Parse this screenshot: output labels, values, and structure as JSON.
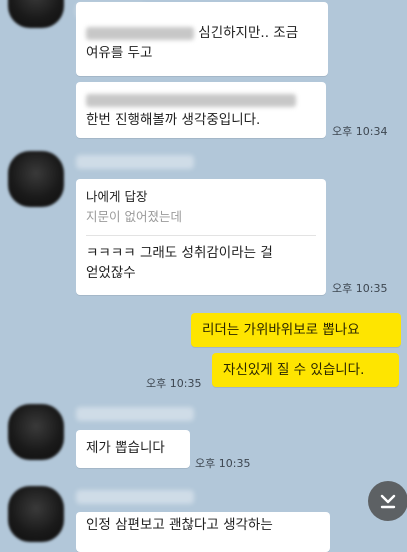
{
  "messages": [
    {
      "id": "m1",
      "visible_text_1": "심긴하지만.. 조금",
      "visible_text_2": "여유를 두고"
    },
    {
      "id": "m2",
      "visible_text_2": "한번 진행해볼까 생각중입니다.",
      "time": "오후 10:34"
    },
    {
      "id": "m3",
      "reply_header": "나에게 답장",
      "reply_quote": "지문이 없어졌는데",
      "text_line_1": "ㅋㅋㅋㅋ 그래도 성취감이라는 걸",
      "text_line_2": "얻었잖수",
      "time": "오후 10:35"
    },
    {
      "id": "m4",
      "text": "리더는 가위바위보로 뽑나요"
    },
    {
      "id": "m5",
      "text": "자신있게 질 수 있습니다.",
      "time": "오후 10:35"
    },
    {
      "id": "m6",
      "text": "제가 뽑습니다",
      "time": "오후 10:35"
    },
    {
      "id": "m7",
      "partial_text": "인정 삼편보고 괜찮다고 생각하는"
    }
  ],
  "scroll_button": {
    "icon": "chevron-down-icon"
  },
  "colors": {
    "background": "#b2c7d9",
    "my_bubble": "#fee500",
    "their_bubble": "#ffffff"
  }
}
